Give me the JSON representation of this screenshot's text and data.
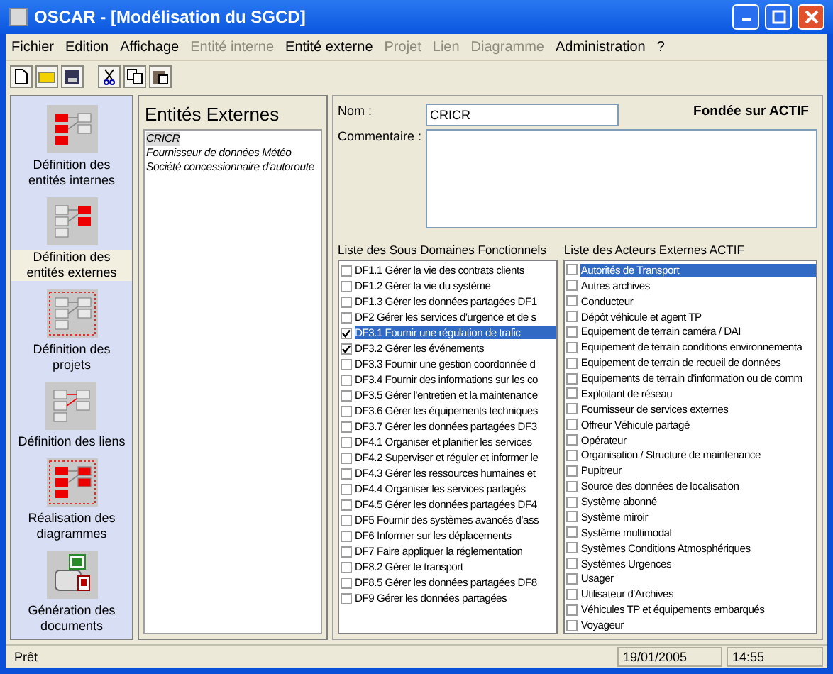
{
  "window": {
    "title": "OSCAR - [Modélisation du SGCD]"
  },
  "menu": [
    {
      "label": "Fichier",
      "disabled": false
    },
    {
      "label": "Edition",
      "disabled": false
    },
    {
      "label": "Affichage",
      "disabled": false
    },
    {
      "label": "Entité interne",
      "disabled": true
    },
    {
      "label": "Entité externe",
      "disabled": false
    },
    {
      "label": "Projet",
      "disabled": true
    },
    {
      "label": "Lien",
      "disabled": true
    },
    {
      "label": "Diagramme",
      "disabled": true
    },
    {
      "label": "Administration",
      "disabled": false
    },
    {
      "label": "?",
      "disabled": false
    }
  ],
  "sidebar": {
    "items": [
      {
        "label": "Définition des entités internes",
        "selected": false
      },
      {
        "label": "Définition des entités externes",
        "selected": true
      },
      {
        "label": "Définition des projets",
        "selected": false
      },
      {
        "label": "Définition des liens",
        "selected": false
      },
      {
        "label": "Réalisation des diagrammes",
        "selected": false
      },
      {
        "label": "Génération des documents",
        "selected": false
      }
    ]
  },
  "entities": {
    "title": "Entités Externes",
    "items": [
      {
        "label": "CRICR",
        "selected": true
      },
      {
        "label": "Fournisseur de données Météo",
        "selected": false
      },
      {
        "label": "Société concessionnaire d'autoroute",
        "selected": false
      }
    ]
  },
  "form": {
    "name_label": "Nom :",
    "name_value": "CRICR",
    "basis": "Fondée sur ACTIF",
    "comment_label": "Commentaire :"
  },
  "sub_domains": {
    "title": "Liste des Sous Domaines Fonctionnels",
    "items": [
      {
        "label": "DF1.1 Gérer la vie des contrats clients",
        "checked": false,
        "selected": false
      },
      {
        "label": "DF1.2 Gérer la vie du système",
        "checked": false,
        "selected": false
      },
      {
        "label": "DF1.3 Gérer les données partagées DF1",
        "checked": false,
        "selected": false
      },
      {
        "label": "DF2 Gérer les services d'urgence et de s",
        "checked": false,
        "selected": false
      },
      {
        "label": "DF3.1 Fournir une régulation de trafic",
        "checked": true,
        "selected": true
      },
      {
        "label": "DF3.2 Gérer les événements",
        "checked": true,
        "selected": false
      },
      {
        "label": "DF3.3 Fournir une gestion coordonnée d",
        "checked": false,
        "selected": false
      },
      {
        "label": "DF3.4 Fournir des informations sur les co",
        "checked": false,
        "selected": false
      },
      {
        "label": "DF3.5 Gérer l'entretien et la maintenance",
        "checked": false,
        "selected": false
      },
      {
        "label": "DF3.6 Gérer les équipements techniques",
        "checked": false,
        "selected": false
      },
      {
        "label": "DF3.7 Gérer les données partagées DF3",
        "checked": false,
        "selected": false
      },
      {
        "label": "DF4.1 Organiser et planifier les services",
        "checked": false,
        "selected": false
      },
      {
        "label": "DF4.2 Superviser et réguler et informer le",
        "checked": false,
        "selected": false
      },
      {
        "label": "DF4.3 Gérer les ressources humaines et",
        "checked": false,
        "selected": false
      },
      {
        "label": "DF4.4 Organiser les services partagés",
        "checked": false,
        "selected": false
      },
      {
        "label": "DF4.5 Gérer les données partagées DF4",
        "checked": false,
        "selected": false
      },
      {
        "label": "DF5 Fournir des systèmes avancés d'ass",
        "checked": false,
        "selected": false
      },
      {
        "label": "DF6 Informer sur les déplacements",
        "checked": false,
        "selected": false
      },
      {
        "label": "DF7 Faire appliquer la réglementation",
        "checked": false,
        "selected": false
      },
      {
        "label": "DF8.2 Gérer le transport",
        "checked": false,
        "selected": false
      },
      {
        "label": "DF8.5 Gérer les données partagées DF8",
        "checked": false,
        "selected": false
      },
      {
        "label": "DF9 Gérer les données partagées",
        "checked": false,
        "selected": false
      }
    ]
  },
  "actors": {
    "title": "Liste des Acteurs Externes ACTIF",
    "items": [
      {
        "label": "Autorités de Transport",
        "checked": false,
        "selected": true
      },
      {
        "label": "Autres archives",
        "checked": false,
        "selected": false
      },
      {
        "label": "Conducteur",
        "checked": false,
        "selected": false
      },
      {
        "label": "Dépôt véhicule et agent TP",
        "checked": false,
        "selected": false
      },
      {
        "label": "Equipement de terrain caméra / DAI",
        "checked": false,
        "selected": false
      },
      {
        "label": "Equipement de terrain conditions environnementa",
        "checked": false,
        "selected": false
      },
      {
        "label": "Equipement de terrain de recueil de données",
        "checked": false,
        "selected": false
      },
      {
        "label": "Equipements de terrain d'information ou de comm",
        "checked": false,
        "selected": false
      },
      {
        "label": "Exploitant de réseau",
        "checked": false,
        "selected": false
      },
      {
        "label": "Fournisseur de services externes",
        "checked": false,
        "selected": false
      },
      {
        "label": "Offreur Véhicule partagé",
        "checked": false,
        "selected": false
      },
      {
        "label": "Opérateur",
        "checked": false,
        "selected": false
      },
      {
        "label": "Organisation / Structure de maintenance",
        "checked": false,
        "selected": false
      },
      {
        "label": "Pupitreur",
        "checked": false,
        "selected": false
      },
      {
        "label": "Source des données de localisation",
        "checked": false,
        "selected": false
      },
      {
        "label": "Système abonné",
        "checked": false,
        "selected": false
      },
      {
        "label": "Système miroir",
        "checked": false,
        "selected": false
      },
      {
        "label": "Système multimodal",
        "checked": false,
        "selected": false
      },
      {
        "label": "Systèmes Conditions Atmosphériques",
        "checked": false,
        "selected": false
      },
      {
        "label": "Systèmes Urgences",
        "checked": false,
        "selected": false
      },
      {
        "label": "Usager",
        "checked": false,
        "selected": false
      },
      {
        "label": "Utilisateur d'Archives",
        "checked": false,
        "selected": false
      },
      {
        "label": "Véhicules TP et équipements embarqués",
        "checked": false,
        "selected": false
      },
      {
        "label": "Voyageur",
        "checked": false,
        "selected": false
      }
    ]
  },
  "status_bar": [
    "Prêt",
    "19/01/2005",
    "14:55"
  ]
}
